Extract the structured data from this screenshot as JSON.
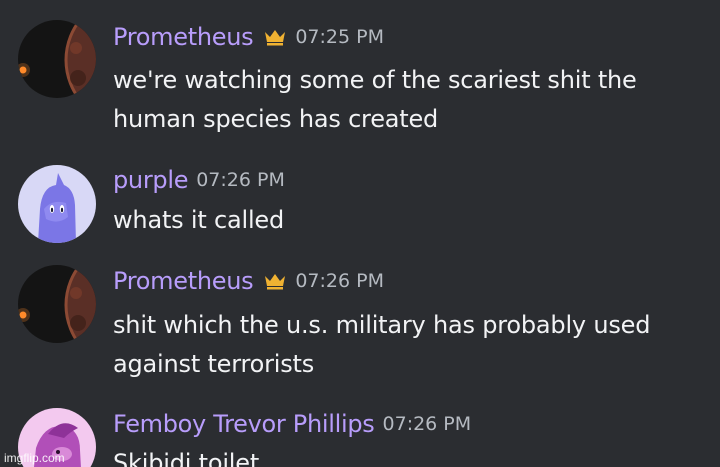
{
  "messages": [
    {
      "author": "Prometheus",
      "has_crown": true,
      "time": "07:25 PM",
      "lines": [
        "we're watching some of the scariest shit the",
        "human species has created"
      ],
      "avatar": "planet-avatar"
    },
    {
      "author": "purple",
      "has_crown": false,
      "time": "07:26 PM",
      "lines": [
        "whats it called"
      ],
      "avatar": "purple-creature-avatar"
    },
    {
      "author": "Prometheus",
      "has_crown": true,
      "time": "07:26 PM",
      "lines": [
        "shit which the u.s. military has probably used",
        "against terrorists"
      ],
      "avatar": "planet-avatar"
    },
    {
      "author": "Femboy Trevor Phillips",
      "has_crown": false,
      "time": "07:26 PM",
      "lines": [
        "Skibidi toilet"
      ],
      "avatar": "pink-creature-avatar"
    }
  ],
  "watermark": "imgflip.com",
  "colors": {
    "background": "#2b2d31",
    "author_name": "#b89dfb",
    "timestamp": "#b5bac1",
    "message_text": "#f2f3f5",
    "crown": "#f0b232"
  }
}
